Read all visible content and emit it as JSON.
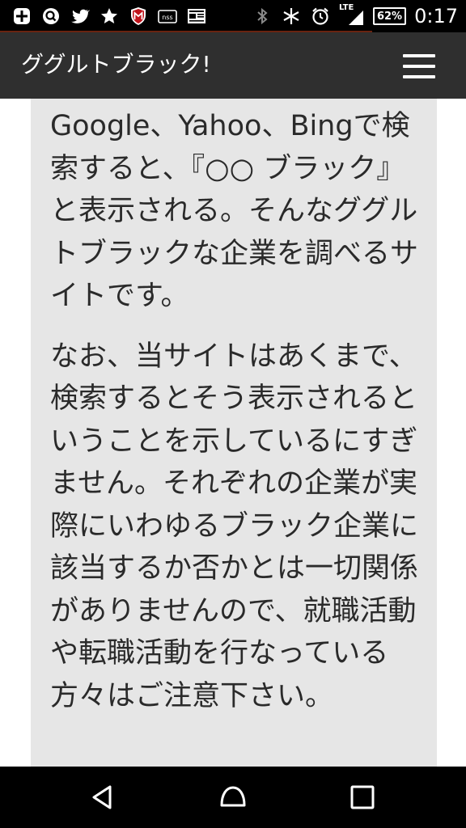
{
  "status_bar": {
    "battery_percent": "62%",
    "network": "LTE",
    "time": "0:17",
    "icons": [
      "add-icon",
      "search-icon",
      "twitter-icon",
      "star-icon",
      "mcafee-icon",
      "app-icon",
      "news-icon",
      "bluetooth-icon",
      "no-vibrate-icon",
      "alarm-icon",
      "signal-icon",
      "battery-icon"
    ]
  },
  "header": {
    "title": "ググルトブラック!",
    "menu_icon": "hamburger-menu-icon"
  },
  "content": {
    "paragraph_1": "Google、Yahoo、Bingで検索すると、『○○ ブラック』と表示される。そんなググルトブラックな企業を調べるサイトです。",
    "paragraph_2": "なお、当サイトはあくまで、検索するとそう表示されるということを示しているにすぎません。それぞれの企業が実際にいわゆるブラック企業に該当するか否かとは一切関係がありませんので、就職活動や転職活動を行なっている方々はご注意下さい。"
  },
  "navigation_bar": {
    "buttons": [
      "back-icon",
      "home-icon",
      "recent-apps-icon"
    ]
  },
  "colors": {
    "header_bg": "#2f2f2f",
    "panel_bg": "#e6e6e6",
    "text": "#2a2a2a"
  }
}
